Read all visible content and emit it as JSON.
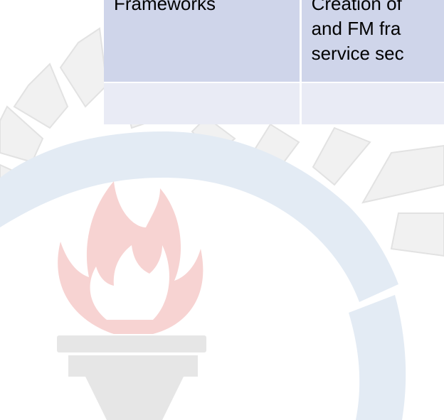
{
  "document": {
    "table": {
      "rows": [
        {
          "cells": [
            {
              "lines": [
                "Frameworks"
              ]
            },
            {
              "lines": [
                "Creation of",
                "and FM fra",
                "service sec"
              ]
            }
          ]
        },
        {
          "cells": [
            {
              "lines": []
            },
            {
              "lines": []
            }
          ]
        }
      ]
    },
    "watermark": {
      "icon": "fire-service-torch-emblem",
      "colors": {
        "flame": "#f7d3d2",
        "torch": "#e6e6e6",
        "ring": "#e3ebf4",
        "rays": "#f1f1f1",
        "ray_outline": "#e2e2e2"
      }
    }
  }
}
